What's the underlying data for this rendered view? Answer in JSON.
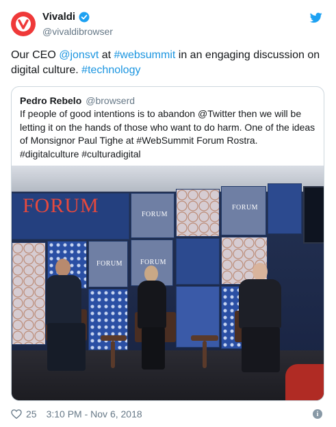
{
  "author": {
    "display_name": "Vivaldi",
    "handle": "@vivaldibrowser",
    "verified": true,
    "avatar_icon": "vivaldi-logo-icon",
    "avatar_color": "#ef3939"
  },
  "tweet": {
    "parts": [
      {
        "text": "Our CEO ",
        "link": false
      },
      {
        "text": "@jonsvt",
        "link": true
      },
      {
        "text": " at ",
        "link": false
      },
      {
        "text": "#websummit",
        "link": true
      },
      {
        "text": " in an engaging discussion on digital culture. ",
        "link": false
      },
      {
        "text": "#technology",
        "link": true
      }
    ]
  },
  "quote": {
    "display_name": "Pedro Rebelo",
    "handle": "@browserd",
    "text": "If people of good intentions is to abandon @Twitter then we will be letting it on the hands of those who want to do harm. One of the ideas of Monsignor Paul Tighe at #WebSummit Forum Rostra. #digitalculture #culturadigital",
    "image_alt": "Panel discussion on stage at Web Summit Forum",
    "signage": {
      "big": "FORUM",
      "small": "FORUM"
    }
  },
  "footer": {
    "likes": "25",
    "timestamp": "3:10 PM - Nov 6, 2018"
  },
  "colors": {
    "link": "#1b95e0",
    "muted": "#657786",
    "twitter_blue": "#1da1f2"
  },
  "icons": [
    "verified-badge-icon",
    "twitter-bird-icon",
    "heart-icon",
    "info-icon"
  ]
}
